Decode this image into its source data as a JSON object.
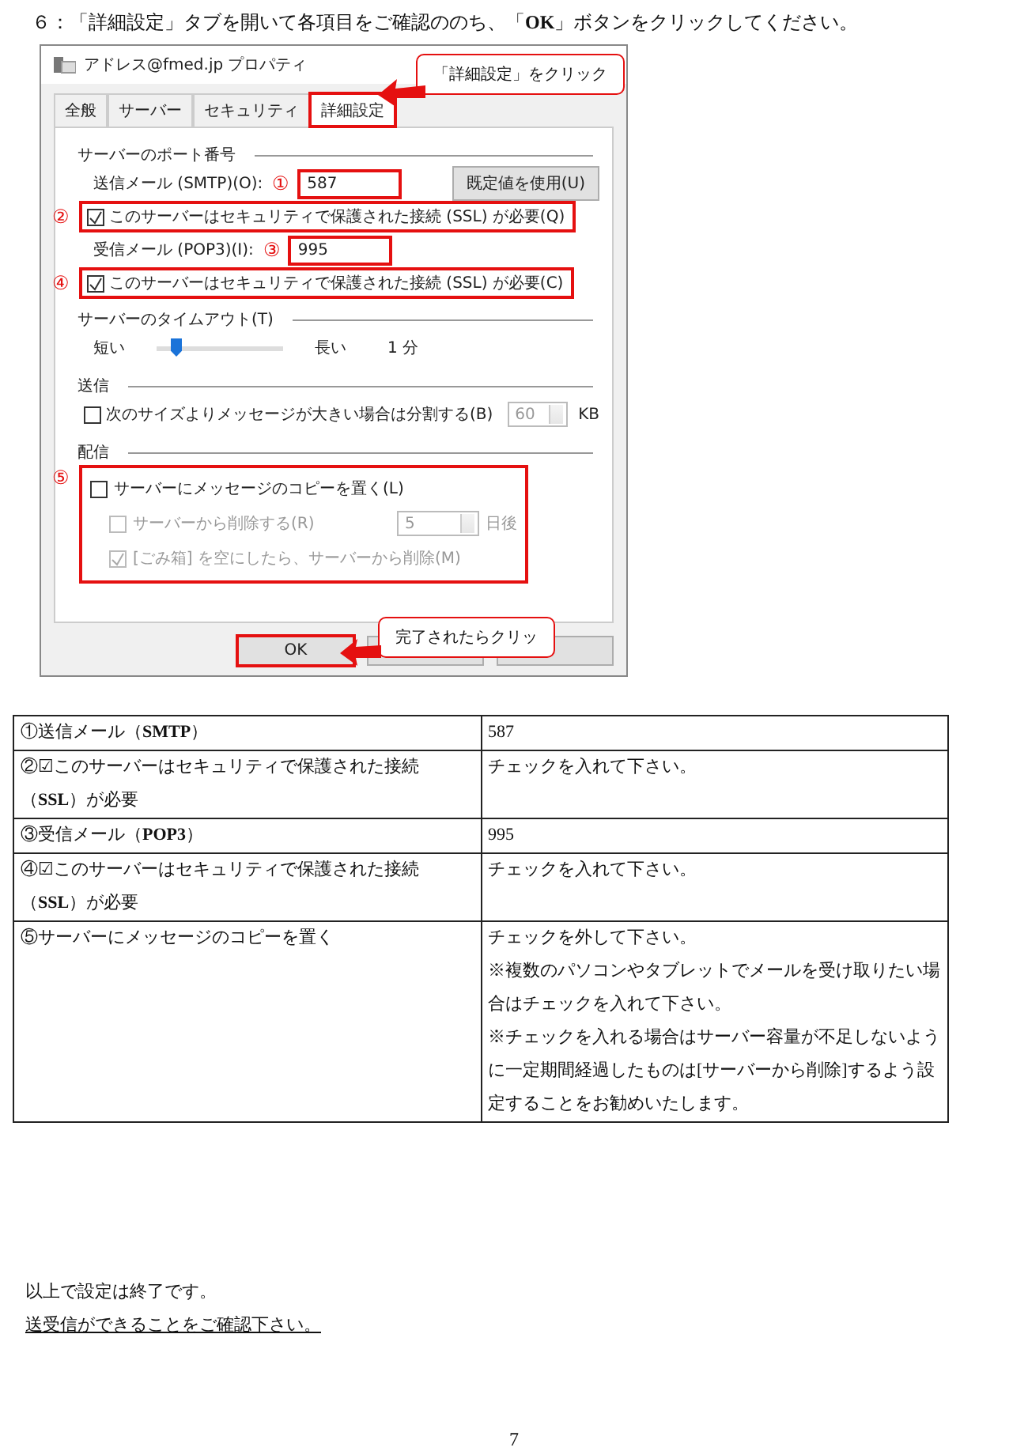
{
  "instruction": "６：「詳細設定」タブを開いて各項目をご確認ののち、「**OK**」ボタンをクリックしてください。",
  "dialog": {
    "title": "アドレス@fmed.jp プロパティ",
    "tabs": [
      {
        "label": "全般",
        "selected": false,
        "highlighted": false
      },
      {
        "label": "サーバー",
        "selected": false,
        "highlighted": false
      },
      {
        "label": "セキュリティ",
        "selected": false,
        "highlighted": false
      },
      {
        "label": "詳細設定",
        "selected": true,
        "highlighted": true
      }
    ],
    "port_heading": "サーバーのポート番号",
    "smtp": {
      "marker": "①",
      "label": "送信メール (SMTP)(O):",
      "value": "587",
      "highlighted": true
    },
    "default_button": "既定値を使用(U)",
    "ssl_smtp": {
      "marker": "②",
      "label": "このサーバーはセキュリティで保護された接続 (SSL) が必要(Q)",
      "checked": true,
      "highlighted": true
    },
    "pop3": {
      "marker": "③",
      "label": "受信メール (POP3)(I):",
      "value": "995",
      "highlighted": true
    },
    "ssl_pop3": {
      "marker": "④",
      "label": "このサーバーはセキュリティで保護された接続 (SSL) が必要(C)",
      "checked": true,
      "highlighted": true
    },
    "timeout": {
      "heading": "サーバーのタイムアウト(T)",
      "short": "短い",
      "long": "長い",
      "level": 0.15,
      "reading": "1 分"
    },
    "send": {
      "heading": "送信",
      "label": "次のサイズよりメッセージが大きい場合は分割する(B)",
      "checked": false,
      "value": "60",
      "unit": "KB"
    },
    "delivery": {
      "heading": "配信",
      "marker": "⑤",
      "highlighted": true,
      "items": [
        {
          "label": "サーバーにメッセージのコピーを置く(L)",
          "checked": false,
          "disabled": false
        },
        {
          "label": "サーバーから削除する(R)",
          "checked": false,
          "disabled": true,
          "value": "5",
          "unit": "日後"
        },
        {
          "label": "[ごみ箱] を空にしたら、サーバーから削除(M)",
          "checked": true,
          "disabled": true
        }
      ]
    },
    "ok_button": {
      "label": "OK",
      "highlighted": true
    },
    "callouts": [
      "「詳細設定」をクリック",
      "完了されたらクリッ"
    ]
  },
  "table": {
    "rows": [
      {
        "item": "①送信メール（**SMTP**）",
        "setting": [
          "587"
        ]
      },
      {
        "item": "②☑このサーバーはセキュリティで保護された接続（**SSL**）が必要",
        "setting": [
          "チェックを入れて下さい。"
        ]
      },
      {
        "item": "③受信メール（**POP3**）",
        "setting": [
          "995"
        ]
      },
      {
        "item": "④☑このサーバーはセキュリティで保護された接続（**SSL**）が必要",
        "setting": [
          "チェックを入れて下さい。"
        ]
      },
      {
        "item": "⑤サーバーにメッセージのコピーを置く",
        "setting": [
          "チェックを外して下さい。",
          "※複数のパソコンやタブレットでメールを受け取りたい場合はチェックを入れて下さい。",
          "※チェックを入れる場合はサーバー容量が不足しないように一定期間経過したものは[サーバーから削除]するよう設定することをお勧めいたします。"
        ]
      }
    ]
  },
  "closing": [
    "以上で設定は終了です。",
    "送受信ができることをご確認下さい。"
  ],
  "page_number": "7"
}
